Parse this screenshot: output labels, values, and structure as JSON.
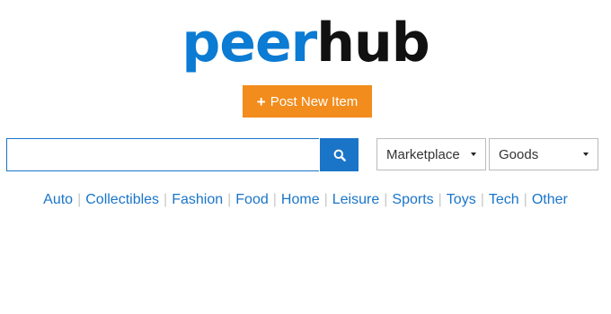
{
  "logo": {
    "part1": "peer",
    "part2": "hub"
  },
  "post_button": {
    "label": "Post New Item"
  },
  "search": {
    "value": "",
    "placeholder": ""
  },
  "filters": {
    "marketplace": "Marketplace",
    "goods": "Goods"
  },
  "categories": [
    "Auto",
    "Collectibles",
    "Fashion",
    "Food",
    "Home",
    "Leisure",
    "Sports",
    "Toys",
    "Tech",
    "Other"
  ],
  "colors": {
    "brand_blue": "#0b7bd3",
    "logo_dark": "#111111",
    "post_orange": "#f28c1c",
    "link_blue": "#1a75c8"
  }
}
